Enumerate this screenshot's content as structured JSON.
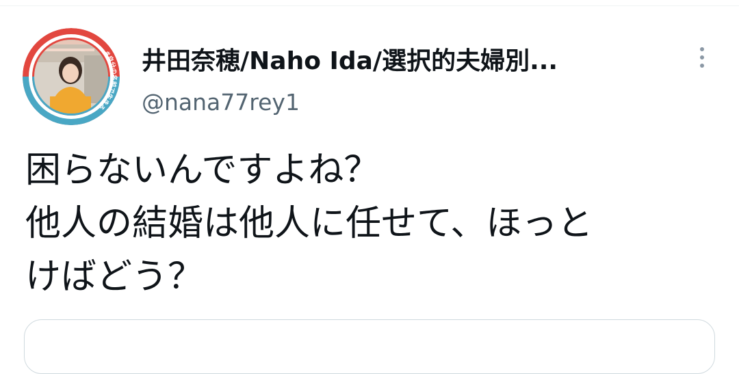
{
  "tweet": {
    "author": {
      "display_name": "井田奈穂/Naho Ida/選択的夫婦別...",
      "handle": "@nana77rey1",
      "avatar_icon": "profile-photo-avatar",
      "avatar_ring_text": "#自分の名前で生きる",
      "avatar_ring_text_short": "棚田"
    },
    "more_icon": "more-vertical-icon",
    "text_lines": [
      "困らないんですよね？",
      "他人の結婚は他人に任せて、ほっと",
      "けばどう？"
    ]
  },
  "colors": {
    "text_primary": "#0f1419",
    "text_secondary": "#536471",
    "border": "#cfd9de",
    "avatar_ring_red": "#e2473f",
    "avatar_ring_teal": "#49a7c4",
    "avatar_shirt": "#f0a830"
  }
}
